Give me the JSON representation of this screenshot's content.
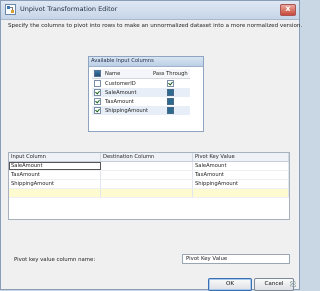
{
  "window": {
    "title": "Unpivot Transformation Editor",
    "title_icon": "transform-editor-icon",
    "close_label": "x",
    "instruction": "Specify the columns to pivot into rows to make an unnormalized dataset into a more normalized version."
  },
  "available": {
    "title": "Available Input Columns",
    "header_name": "Name",
    "header_pass": "Pass Through",
    "rows": [
      {
        "name": "CustomerID",
        "checked": false,
        "pass_through": true
      },
      {
        "name": "SaleAmount",
        "checked": true,
        "pass_through": false
      },
      {
        "name": "TaxAmount",
        "checked": true,
        "pass_through": false
      },
      {
        "name": "ShippingAmount",
        "checked": true,
        "pass_through": false
      }
    ]
  },
  "mapping": {
    "headers": [
      "Input Column",
      "Destination Column",
      "Pivot Key Value"
    ],
    "rows": [
      [
        "SaleAmount",
        "",
        "SaleAmount"
      ],
      [
        "TaxAmount",
        "",
        "TaxAmount"
      ],
      [
        "ShippingAmount",
        "",
        "ShippingAmount"
      ],
      [
        "",
        "",
        ""
      ]
    ]
  },
  "pivot_key": {
    "label": "Pivot key value column name:",
    "value": "Pivot Key Value"
  },
  "buttons": {
    "ok": "OK",
    "cancel": "Cancel"
  }
}
